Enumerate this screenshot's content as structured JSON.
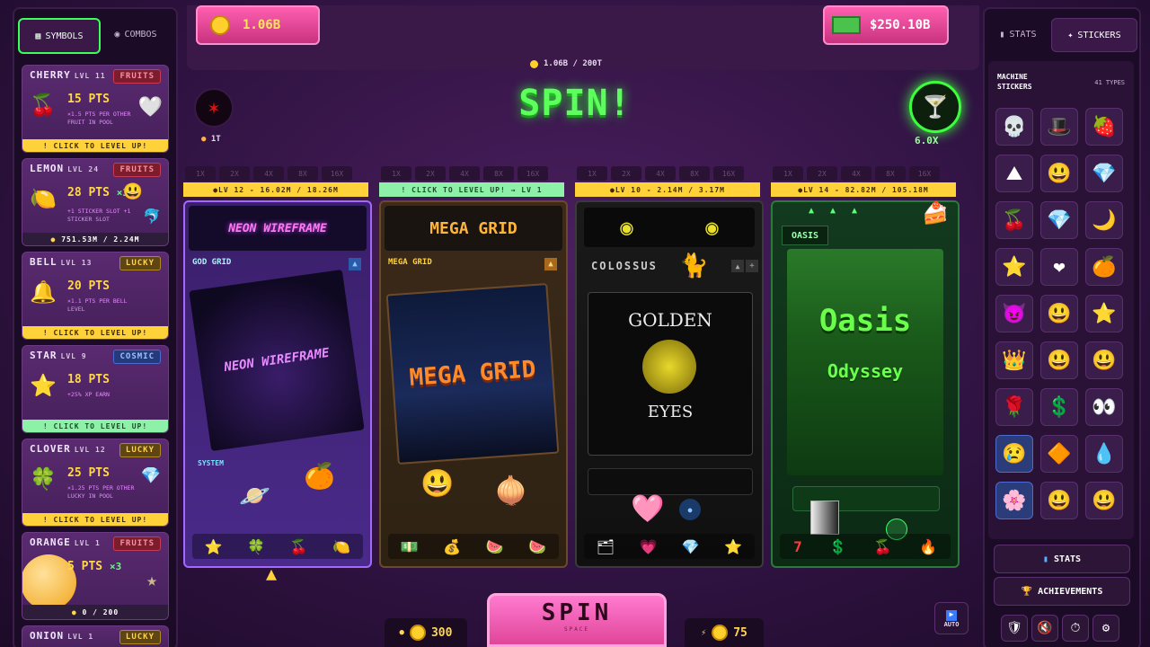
{
  "tabs": {
    "symbols": "SYMBOLS",
    "combos": "COMBOS",
    "stats": "STATS",
    "stickers": "STICKERS"
  },
  "currency": {
    "coins": "1.06B",
    "cash": "$250.10B",
    "progress": "1.06B / 200T"
  },
  "profile": {
    "label": "1T"
  },
  "spin_title": "SPIN!",
  "multiplier_badge": "6.0X",
  "symbols": [
    {
      "name": "CHERRY",
      "level": "LVL 11",
      "tag": "FRUITS",
      "pts": "15 PTS",
      "desc": "×1.5 PTS PER OTHER FRUIT IN POOL",
      "bar": "! CLICK TO LEVEL UP!",
      "icon": "🍒"
    },
    {
      "name": "LEMON",
      "level": "LVL 24",
      "tag": "FRUITS",
      "pts": "28 PTS",
      "mult": "×3",
      "desc": "+1 STICKER SLOT  +1 STICKER SLOT",
      "bar": "751.53M / 2.24M",
      "icon": "🍋"
    },
    {
      "name": "BELL",
      "level": "LVL 13",
      "tag": "LUCKY",
      "pts": "20 PTS",
      "desc": "×1.1 PTS PER BELL LEVEL",
      "bar": "! CLICK TO LEVEL UP!",
      "icon": "🔔"
    },
    {
      "name": "STAR",
      "level": "LVL 9",
      "tag": "COSMIC",
      "pts": "18 PTS",
      "desc": "+25% XP EARN",
      "bar": "! CLICK TO LEVEL UP!",
      "icon": "⭐"
    },
    {
      "name": "CLOVER",
      "level": "LVL 12",
      "tag": "LUCKY",
      "pts": "25 PTS",
      "desc": "×1.25 PTS PER OTHER LUCKY IN POOL",
      "bar": "! CLICK TO LEVEL UP!",
      "icon": "🍀"
    },
    {
      "name": "ORANGE",
      "level": "LVL 1",
      "tag": "FRUITS",
      "pts": "5 PTS",
      "mult": "×3",
      "desc": "",
      "bar": "0 / 200",
      "icon": "🍊"
    },
    {
      "name": "ONION",
      "level": "LVL 1",
      "tag": "LUCKY",
      "pts": "",
      "desc": "",
      "bar": "",
      "icon": "🧅"
    }
  ],
  "multipliers": [
    "1X",
    "2X",
    "4X",
    "8X",
    "16X"
  ],
  "machines": [
    {
      "banner": "LV 12 - 16.02M / 18.26M",
      "name": "GOD GRID",
      "art_title": "NEON WIREFRAME",
      "section": "SYSTEM",
      "reels": [
        "⭐",
        "🍀",
        "🍒",
        "🍋"
      ]
    },
    {
      "banner": "! CLICK TO LEVEL UP! → LV 1",
      "name": "MEGA GRID",
      "art_title": "MEGA GRID",
      "reels": [
        "💵",
        "💰",
        "🍉",
        "🍉"
      ]
    },
    {
      "banner": "LV 10 - 2.14M / 3.17M",
      "name": "COLOSSUS",
      "art_title_top": "GOLDEN",
      "art_title_bottom": "EYES",
      "reels": [
        "🗂",
        "💗",
        "💎",
        "⭐"
      ]
    },
    {
      "banner": "LV 14 - 82.82M / 105.18M",
      "name": "OASIS",
      "art_title_top": "Oasis",
      "art_title_bottom": "Odyssey",
      "reels": [
        "7",
        "💲",
        "🍒",
        "🔥"
      ]
    }
  ],
  "stickers_header": {
    "title": "MACHINE STICKERS",
    "count": "41 TYPES"
  },
  "sticker_icons": [
    "💀",
    "🎩",
    "🍓",
    "⛰",
    "😃",
    "💎",
    "🍒",
    "💎",
    "🌙",
    "⭐",
    "❤",
    "🍊",
    "😈",
    "😃",
    "⭐",
    "👑",
    "😃",
    "😃",
    "🌹",
    "💲",
    "👀",
    "😢",
    "🔶",
    "💧",
    "🌸",
    "😃",
    "😃"
  ],
  "right_buttons": {
    "stats": "STATS",
    "achievements": "ACHIEVEMENTS"
  },
  "bottom": {
    "coins": "300",
    "energy": "75",
    "spin": "SPIN",
    "spin_sub": "SPACE",
    "auto": "AUTO"
  }
}
